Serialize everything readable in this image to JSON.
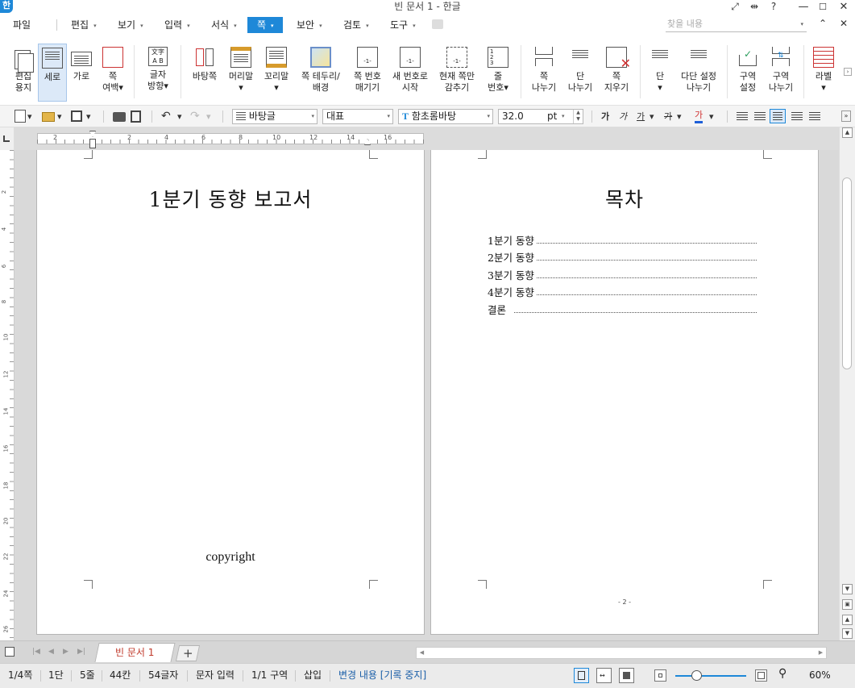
{
  "window": {
    "title": "빈 문서 1 - 한글",
    "logo": "한",
    "controls": {
      "fit": "⤢",
      "split": "⇹",
      "help": "?",
      "minimize": "—",
      "maximize": "☐",
      "close": "✕"
    }
  },
  "menubar": {
    "file": "파일",
    "items": [
      {
        "label": "편집",
        "caret": "▾"
      },
      {
        "label": "보기",
        "caret": "▾"
      },
      {
        "label": "입력",
        "caret": "▾"
      },
      {
        "label": "서식",
        "caret": "▾"
      },
      {
        "label": "쪽",
        "caret": "▾",
        "active": true
      },
      {
        "label": "보안",
        "caret": "▾"
      },
      {
        "label": "검토",
        "caret": "▾"
      },
      {
        "label": "도구",
        "caret": "▾"
      }
    ],
    "search_placeholder": "찾을 내용",
    "search_caret": "▾",
    "collapse": "⌃",
    "close_doc": "✕"
  },
  "ribbon": {
    "buttons": [
      {
        "id": "edit-paper",
        "label": "편집\n용지"
      },
      {
        "id": "portrait",
        "label": "세로",
        "active": true
      },
      {
        "id": "landscape",
        "label": "가로"
      },
      {
        "id": "page-margin",
        "label": "쪽\n여백▾"
      },
      {
        "id": "text-direction",
        "label": "글자\n방향▾"
      },
      {
        "id": "background-page",
        "label": "바탕쪽"
      },
      {
        "id": "header",
        "label": "머리말\n▾"
      },
      {
        "id": "footer",
        "label": "꼬리말\n▾"
      },
      {
        "id": "page-border",
        "label": "쪽 테두리/\n배경"
      },
      {
        "id": "page-number",
        "label": "쪽 번호\n매기기"
      },
      {
        "id": "new-number",
        "label": "새 번호로\n시작"
      },
      {
        "id": "hide-current",
        "label": "현재 쪽만\n감추기"
      },
      {
        "id": "line-number",
        "label": "줄\n번호▾"
      },
      {
        "id": "page-break",
        "label": "쪽\n나누기"
      },
      {
        "id": "column-break",
        "label": "단\n나누기"
      },
      {
        "id": "delete-page",
        "label": "쪽\n지우기"
      },
      {
        "id": "columns",
        "label": "단\n▾"
      },
      {
        "id": "multi-column-break",
        "label": "다단 설정\n나누기"
      },
      {
        "id": "section-setup",
        "label": "구역\n설정"
      },
      {
        "id": "section-break",
        "label": "구역\n나누기"
      },
      {
        "id": "label",
        "label": "라벨\n▾"
      }
    ]
  },
  "toolbar": {
    "style": "바탕글",
    "language": "대표",
    "font": "함초롬바탕",
    "font_prefix": "T",
    "size": "32.0",
    "unit": "pt",
    "bold": "가",
    "italic": "가",
    "underline": "가",
    "strike": "가",
    "color": "가",
    "caret": "▾"
  },
  "ruler": {
    "h_numbers": [
      "2",
      "2",
      "4",
      "6",
      "8",
      "10",
      "12",
      "14",
      "16"
    ],
    "v_numbers": [
      "2",
      "4",
      "6",
      "8",
      "10",
      "12",
      "14",
      "16",
      "18",
      "20",
      "22",
      "24",
      "26"
    ]
  },
  "document": {
    "page1": {
      "title": "1분기  동향  보고서",
      "copyright": "copyright"
    },
    "page2": {
      "title": "목차",
      "toc": [
        {
          "text": "1분기  동향"
        },
        {
          "text": "2분기  동향"
        },
        {
          "text": "3분기  동향"
        },
        {
          "text": "4분기  동향"
        },
        {
          "text": "결론"
        }
      ],
      "page_number": "- 2 -"
    }
  },
  "tabs": {
    "current": "빈 문서 1",
    "add": "+"
  },
  "statusbar": {
    "page": "1/4쪽",
    "column": "1단",
    "line": "5줄",
    "cell": "44칸",
    "chars": "54글자",
    "mode": "문자 입력",
    "section": "1/1 구역",
    "insert": "삽입",
    "track": "변경 내용 [기록 중지]",
    "zoom": "60%",
    "zoom_value": 0.6
  },
  "colors": {
    "accent": "#1e88d8",
    "tab_text": "#c0392b"
  }
}
